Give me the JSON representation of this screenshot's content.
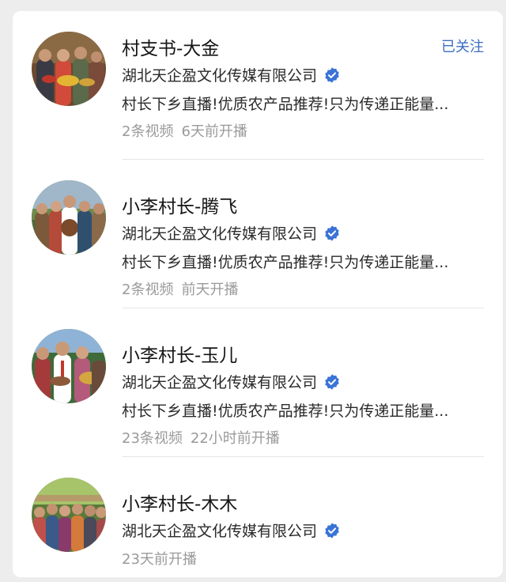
{
  "colors": {
    "verified_badge": "#3b73d6",
    "follow_link": "#3b6fc4",
    "meta_text": "#9a9a9a"
  },
  "items": [
    {
      "name": "村支书-大金",
      "follow_label": "已关注",
      "company": "湖北天企盈文化传媒有限公司",
      "verified_icon": "verified-check-icon",
      "description": "村长下乡直播!优质农产品推荐!只为传递正能量...",
      "video_count": "2条视频",
      "live_time": "6天前开播"
    },
    {
      "name": "小李村长-腾飞",
      "company": "湖北天企盈文化传媒有限公司",
      "verified_icon": "verified-check-icon",
      "description": "村长下乡直播!优质农产品推荐!只为传递正能量...",
      "video_count": "2条视频",
      "live_time": "前天开播"
    },
    {
      "name": "小李村长-玉儿",
      "company": "湖北天企盈文化传媒有限公司",
      "verified_icon": "verified-check-icon",
      "description": "村长下乡直播!优质农产品推荐!只为传递正能量...",
      "video_count": "23条视频",
      "live_time": "22小时前开播"
    },
    {
      "name": "小李村长-木木",
      "company": "湖北天企盈文化传媒有限公司",
      "verified_icon": "verified-check-icon",
      "live_time": "23天前开播"
    }
  ]
}
